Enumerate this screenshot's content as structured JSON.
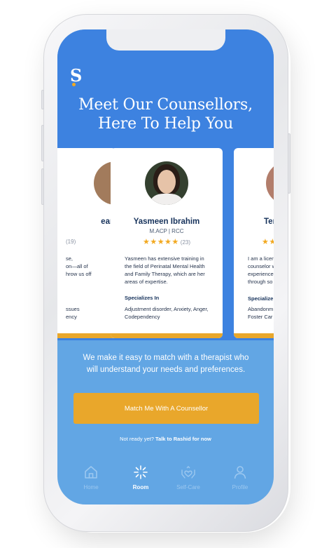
{
  "headline": {
    "line1": "Meet Our Counsellors,",
    "line2": "Here To Help You"
  },
  "brand": {
    "logo_letter": "S"
  },
  "counsellors": [
    {
      "name_partial": "ean",
      "reviews_partial": "(19)",
      "bio_partial": [
        "se,",
        "on—all of",
        "hrow us off"
      ],
      "spec_partial": [
        "ssues",
        "ency"
      ]
    },
    {
      "name": "Yasmeen Ibrahim",
      "credentials": "M.ACP | RCC",
      "stars": "★★★★★",
      "reviews": "(23)",
      "bio": "Yasmeen has extensive training in the field of Perinatal Mental Health and Family Therapy, which are her areas of expertise.",
      "specializes_title": "Specializes In",
      "specializes": "Adjustment disorder, Anxiety, Anger, Codependency"
    },
    {
      "name_partial": "Ter",
      "stars_partial": "★★",
      "bio_partial": [
        "I am a licen",
        "counselor w",
        "experience",
        "through so"
      ],
      "spec_title_partial": "Specialize",
      "spec_partial": [
        "Abandonm",
        "Foster Car"
      ]
    }
  ],
  "tagline": "We make it easy to match with a therapist who will understand your needs and preferences.",
  "cta_label": "Match Me With A Counsellor",
  "subcta": {
    "prefix": "Not ready yet?",
    "link": "Talk to Rashid for now"
  },
  "tabs": [
    {
      "label": "Home",
      "icon": "home-icon",
      "active": false
    },
    {
      "label": "Room",
      "icon": "sparkle-icon",
      "active": true
    },
    {
      "label": "Self-Care",
      "icon": "heart-hands-icon",
      "active": false
    },
    {
      "label": "Profile",
      "icon": "person-icon",
      "active": false
    }
  ],
  "colors": {
    "primary_blue": "#3d82e0",
    "light_blue": "#62a6e4",
    "accent_orange": "#e9a72b",
    "star_gold": "#f2a920",
    "navy": "#16325b"
  }
}
